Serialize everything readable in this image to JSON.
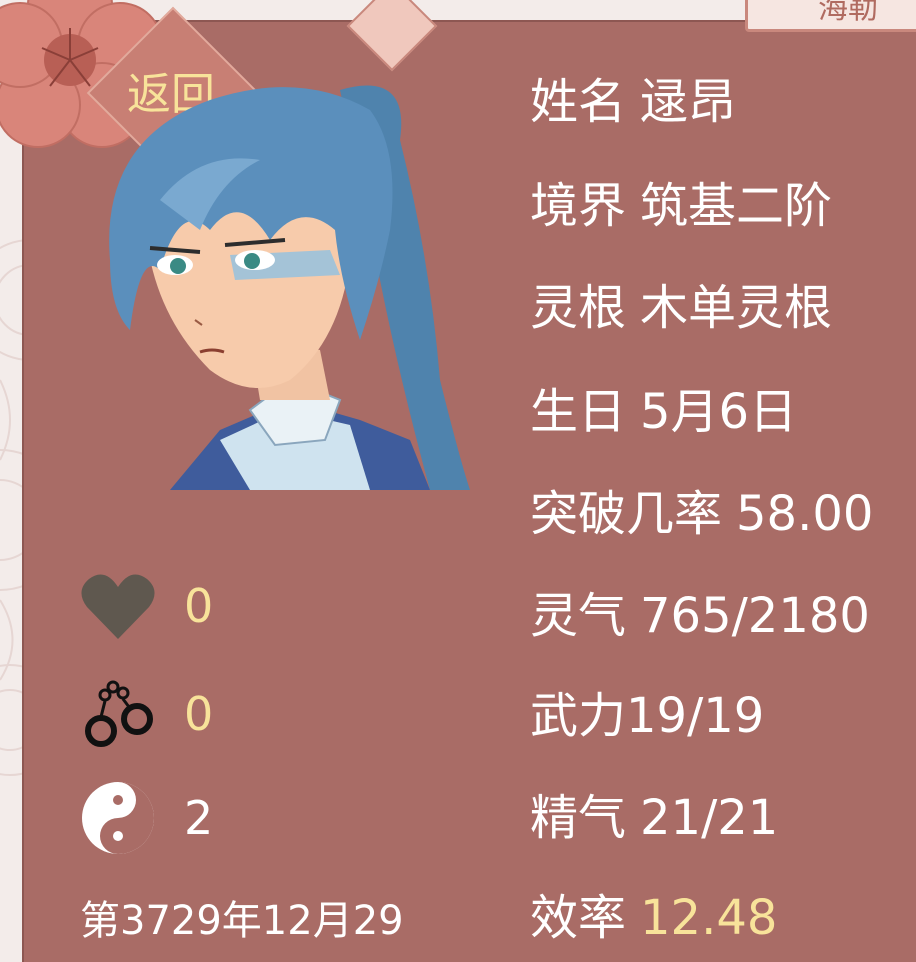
{
  "top_button": {
    "label": "海勒"
  },
  "back_button": {
    "label": "返回"
  },
  "character": {
    "name_label": "姓名",
    "name": "逯昂",
    "realm_label": "境界",
    "realm": "筑基二阶",
    "root_label": "灵根",
    "root": "木单灵根",
    "birthday_label": "生日",
    "birthday": "5月6日",
    "breakthrough_label": "突破几率",
    "breakthrough": "58.00",
    "spirit_label": "灵气",
    "spirit": "765/2180",
    "force_label": "武力",
    "force": "19/19",
    "essence_label": "精气",
    "essence": "21/21",
    "efficiency_label": "效率",
    "efficiency": "12.48"
  },
  "stats": {
    "affection": "0",
    "restraint": "0",
    "yinyang": "2"
  },
  "date": "第3729年12月29",
  "colors": {
    "panel": "#a96c66",
    "accent_yellow": "#f8e39a",
    "text": "#ffffff",
    "heart": "#5f584f"
  }
}
